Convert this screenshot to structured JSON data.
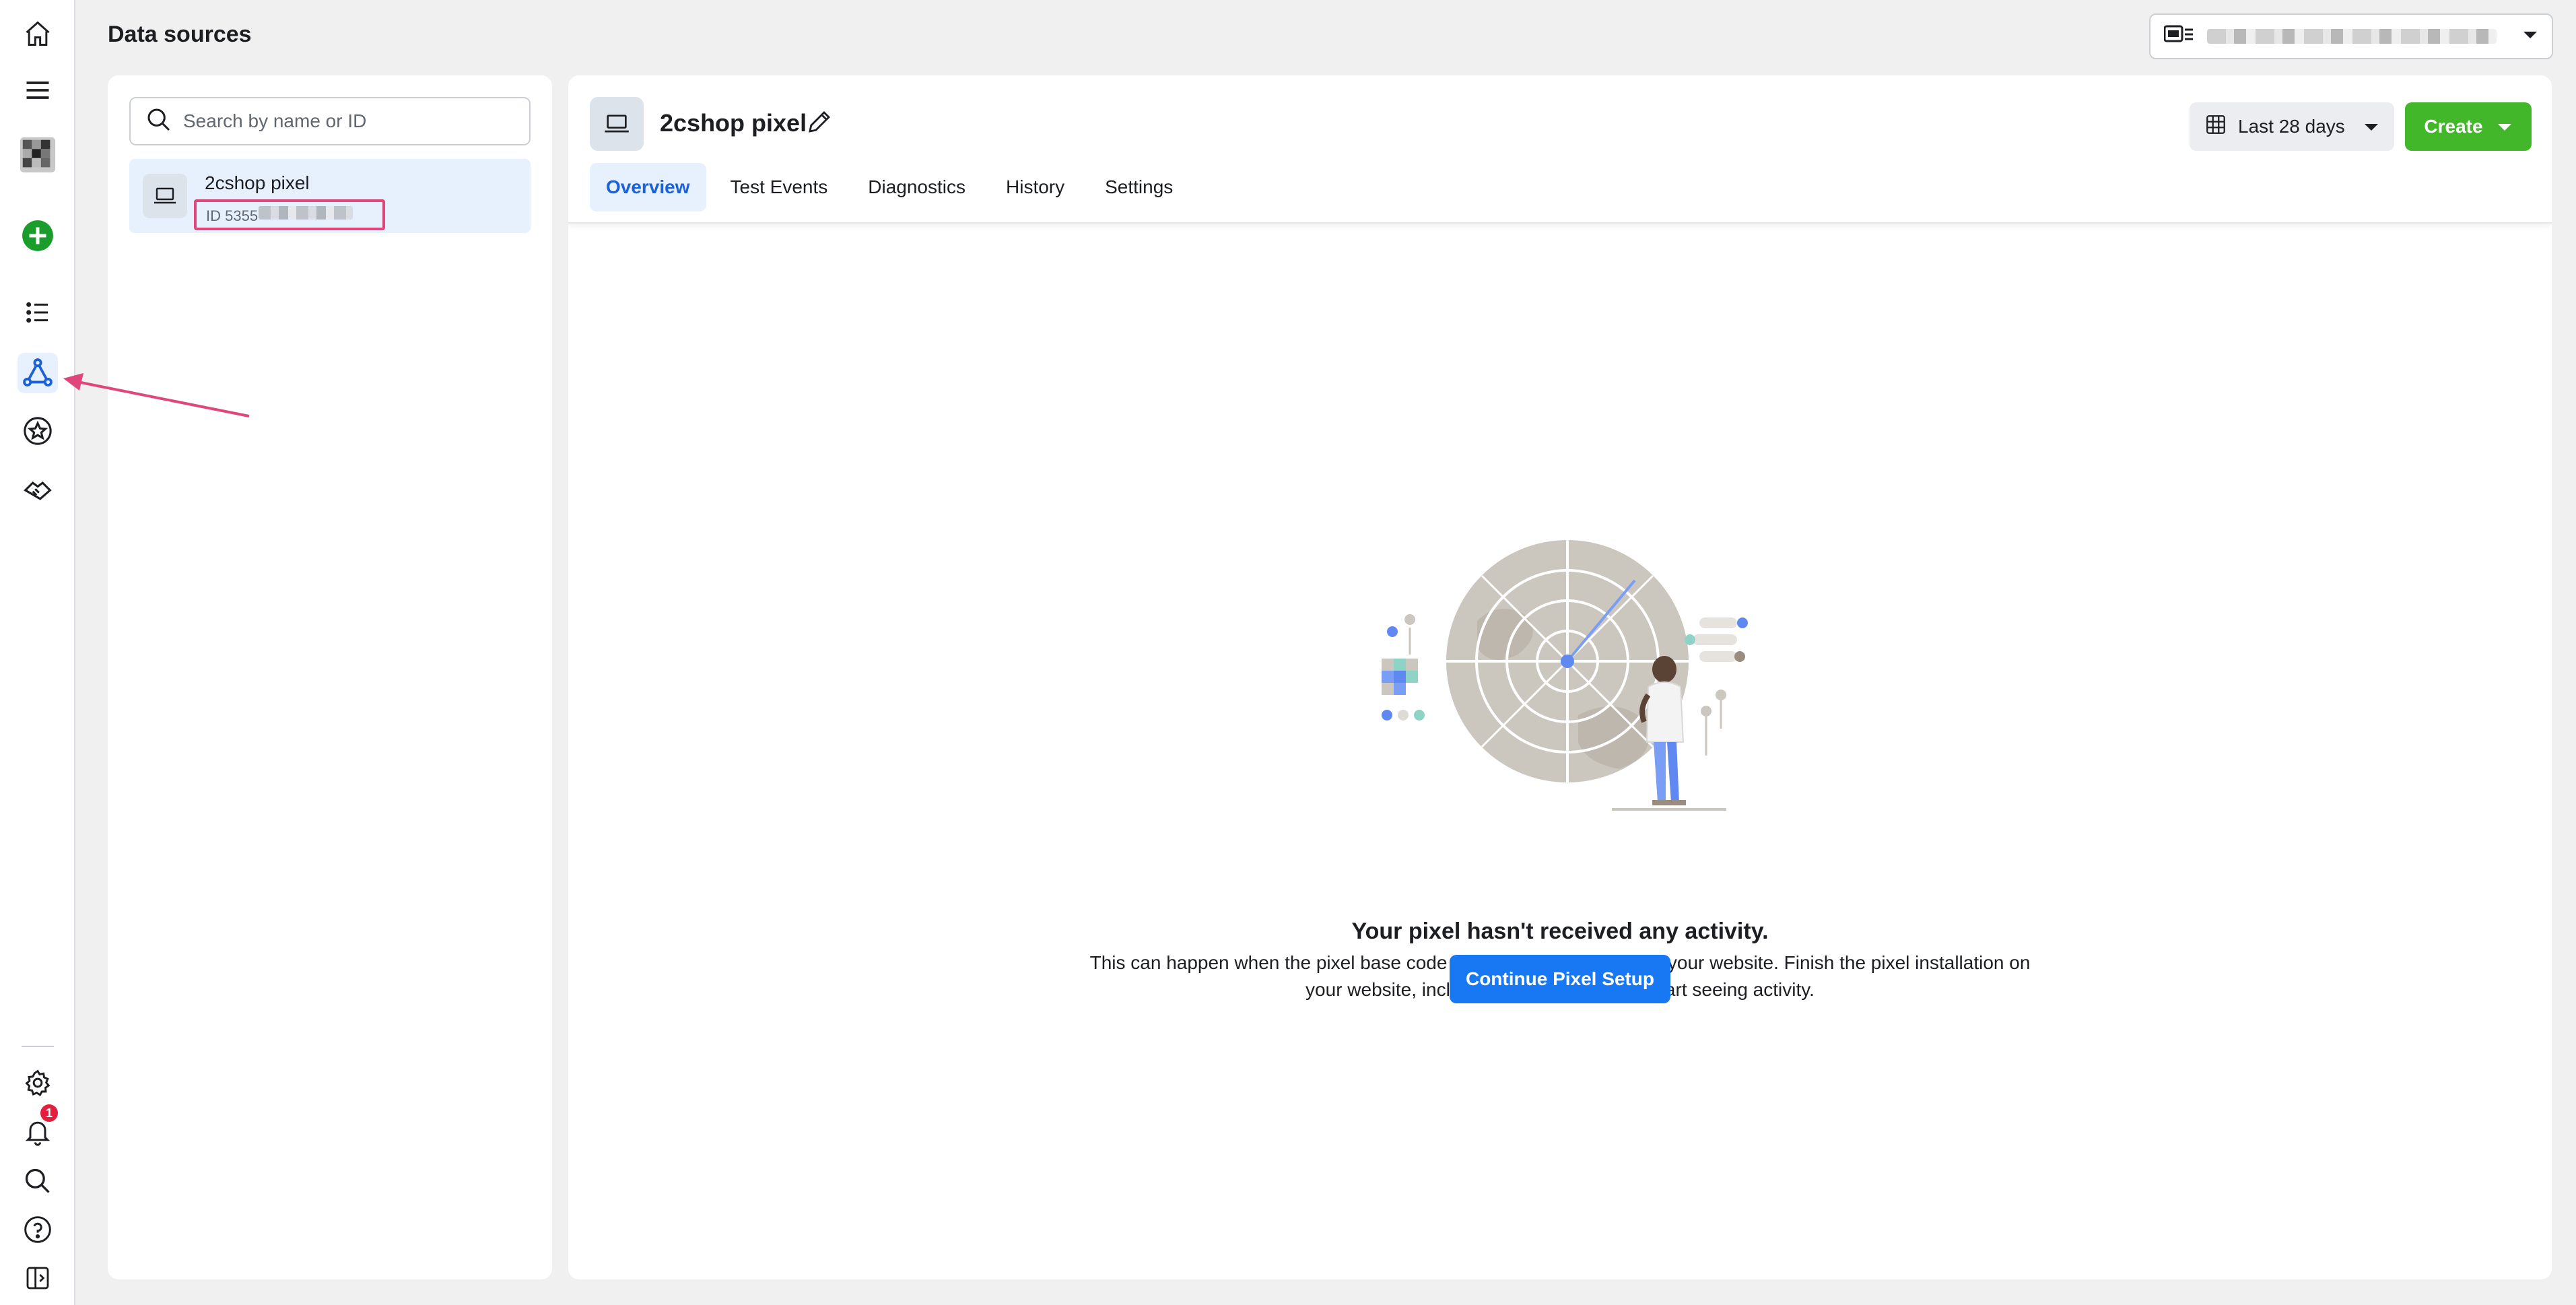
{
  "page": {
    "title": "Data sources"
  },
  "rail": {
    "notification_count": "1"
  },
  "search": {
    "placeholder": "Search by name or ID"
  },
  "source_list": [
    {
      "name": "2cshop pixel",
      "id_label": "ID 5355"
    }
  ],
  "pixel": {
    "name": "2cshop pixel"
  },
  "tabs": [
    {
      "label": "Overview"
    },
    {
      "label": "Test Events"
    },
    {
      "label": "Diagnostics"
    },
    {
      "label": "History"
    },
    {
      "label": "Settings"
    }
  ],
  "toolbar": {
    "date_range": "Last 28 days",
    "create_label": "Create"
  },
  "empty_state": {
    "title": "Your pixel hasn't received any activity.",
    "line1": "This can happen when the pixel base code isn't installed correctly on your website. Finish the pixel installation on",
    "line2": "your website, including adding events, to start seeing activity.",
    "cta": "Continue Pixel Setup"
  },
  "colors": {
    "primary_blue": "#1877f2",
    "create_green": "#42b72a",
    "active_tab_bg": "#e7f0fd",
    "annotation_pink": "#e0457b",
    "badge_red": "#e41e3f"
  }
}
